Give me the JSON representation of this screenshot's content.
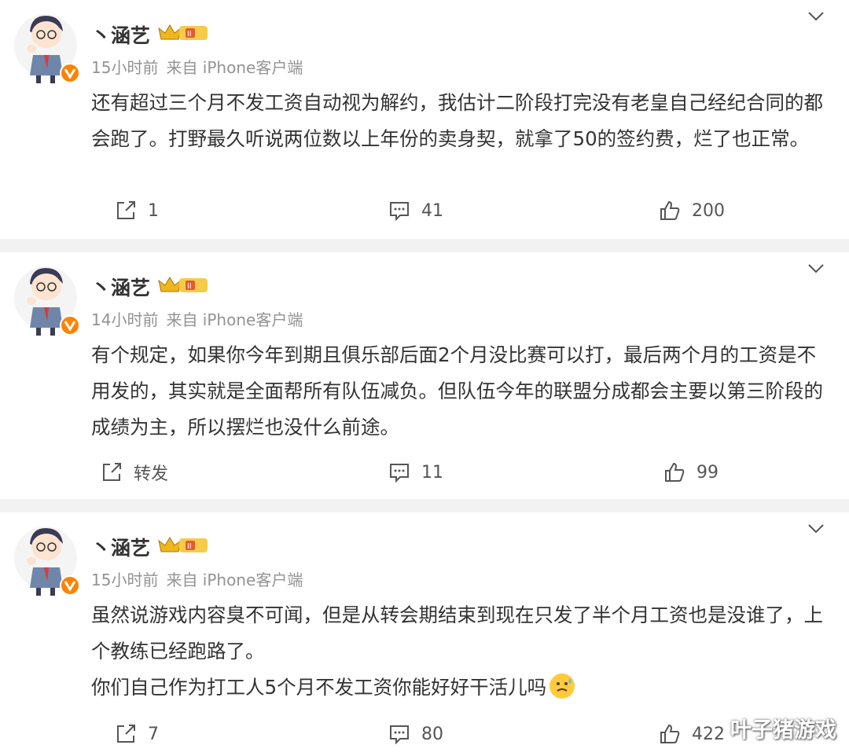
{
  "posts": [
    {
      "name": "丶涵艺",
      "time": "15小时前",
      "source": "来自 iPhone客户端",
      "content": [
        "还有超过三个月不发工资自动视为解约，我估计二阶段打完没有老皇自己经纪合同的都会跑了。打野最久听说两位数以上年份的卖身契，就拿了50的签约费，烂了也正常。"
      ],
      "repost": "1",
      "comments": "41",
      "likes": "200"
    },
    {
      "name": "丶涵艺",
      "time": "14小时前",
      "source": "来自 iPhone客户端",
      "content": [
        "有个规定，如果你今年到期且俱乐部后面2个月没比赛可以打，最后两个月的工资是不用发的，其实就是全面帮所有队伍减负。但队伍今年的联盟分成都会主要以第三阶段的成绩为主，所以摆烂也没什么前途。"
      ],
      "repost": "转发",
      "comments": "11",
      "likes": "99"
    },
    {
      "name": "丶涵艺",
      "time": "15小时前",
      "source": "来自 iPhone客户端",
      "content": [
        "虽然说游戏内容臭不可闻，但是从转会期结束到现在只发了半个月工资也是没谁了，上个教练已经跑路了。",
        "你们自己作为打工人5个月不发工资你能好好干活儿吗"
      ],
      "repost": "7",
      "comments": "80",
      "likes": "422"
    }
  ],
  "watermark": "叶子猪游戏",
  "colors": {
    "meta": "#939393",
    "text": "#333333",
    "badge": "#ff8200",
    "separator": "#f2f2f2"
  }
}
